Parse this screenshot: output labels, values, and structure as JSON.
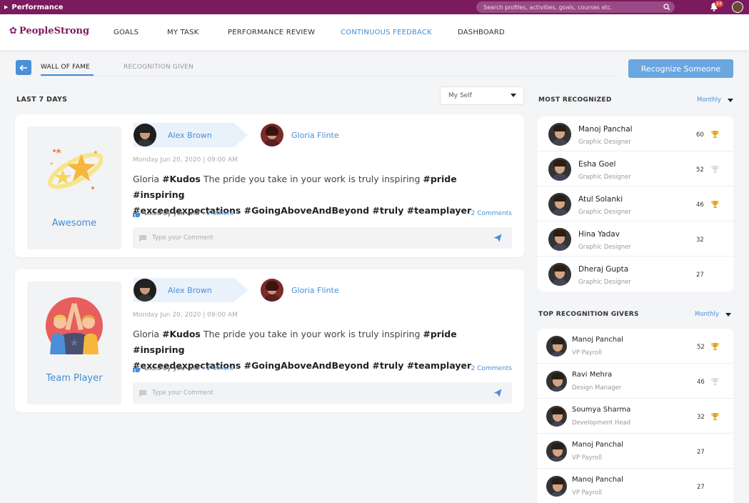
{
  "topbar": {
    "app_title": "Performance",
    "search_placeholder": "Search profiles, activities, goals, courses etc.",
    "notification_count": "24"
  },
  "nav": {
    "brand": "PeopleStrong",
    "items": [
      {
        "label": "GOALS"
      },
      {
        "label": "MY TASK"
      },
      {
        "label": "PERFORMANCE REVIEW"
      },
      {
        "label": "CONTINUOUS FEEDBACK",
        "active": true
      },
      {
        "label": "DASHBOARD"
      }
    ]
  },
  "subtabs": {
    "wall_of_fame": "WALL OF FAME",
    "recognition_given": "RECOGNITION GIVEN",
    "recognize_button": "Recognize Someone"
  },
  "feed": {
    "period_label": "LAST 7 DAYS",
    "filter_value": "My Self",
    "posts": [
      {
        "badge": "Awesome",
        "giver": "Alex Brown",
        "receiver": "Gloria Flinte",
        "date": "Monday Jun 20, 2020  |  09:00 AM",
        "msg_prefix": "Gloria ",
        "msg_kudos": "#Kudos",
        "msg_body": " The pride you take in your work is truly inspiring ",
        "msg_tags1": "#pride #inspiring",
        "msg_tags2": "#exceedexpectations #GoingAboveAndBeyond #truly #teamplayer",
        "likes_text": "Liked by you and",
        "likes_others": "+2 others",
        "comments": "2 Comments",
        "comment_placeholder": "Type your Comment"
      },
      {
        "badge": "Team Player",
        "giver": "Alex Brown",
        "receiver": "Gloria Flinte",
        "date": "Monday Jun 20, 2020  |  09:00 AM",
        "msg_prefix": "Gloria ",
        "msg_kudos": "#Kudos",
        "msg_body": " The pride you take in your work is truly inspiring ",
        "msg_tags1": "#pride #inspiring",
        "msg_tags2": "#exceedexpectations #GoingAboveAndBeyond #truly #teamplayer",
        "likes_text": "Liked by you and",
        "likes_others": "+2 others",
        "comments": "2 Comments",
        "comment_placeholder": "Type your Comment"
      }
    ]
  },
  "most_recognized": {
    "title": "MOST RECOGNIZED",
    "filter": "Monthly",
    "people": [
      {
        "name": "Manoj Panchal",
        "role": "Graphic Designer",
        "count": "60",
        "trophy": "gold"
      },
      {
        "name": "Esha Goel",
        "role": "Graphic Designer",
        "count": "52",
        "trophy": "silver"
      },
      {
        "name": "Atul Solanki",
        "role": "Graphic Designer",
        "count": "46",
        "trophy": "gold"
      },
      {
        "name": "Hina Yadav",
        "role": "Graphic Designer",
        "count": "32",
        "trophy": "none"
      },
      {
        "name": "Dheraj Gupta",
        "role": "Graphic Designer",
        "count": "27",
        "trophy": "none"
      }
    ]
  },
  "top_givers": {
    "title": "TOP RECOGNITION GIVERS",
    "filter": "Monthly",
    "people": [
      {
        "name": "Manoj Panchal",
        "role": "VP Payroll",
        "count": "52",
        "trophy": "gold"
      },
      {
        "name": "Ravi Mehra",
        "role": "Design Manager",
        "count": "46",
        "trophy": "silver"
      },
      {
        "name": "Soumya Sharma",
        "role": "Development Head",
        "count": "32",
        "trophy": "gold"
      },
      {
        "name": "Manoj Panchal",
        "role": "VP Payroll",
        "count": "27",
        "trophy": "none"
      },
      {
        "name": "Manoj Panchal",
        "role": "VP Payroll",
        "count": "27",
        "trophy": "none"
      }
    ]
  },
  "colors": {
    "brand": "#7b1a5e",
    "accent": "#4a8fd8",
    "trophy_gold": "#e8a317",
    "trophy_silver": "#d8dadd"
  }
}
